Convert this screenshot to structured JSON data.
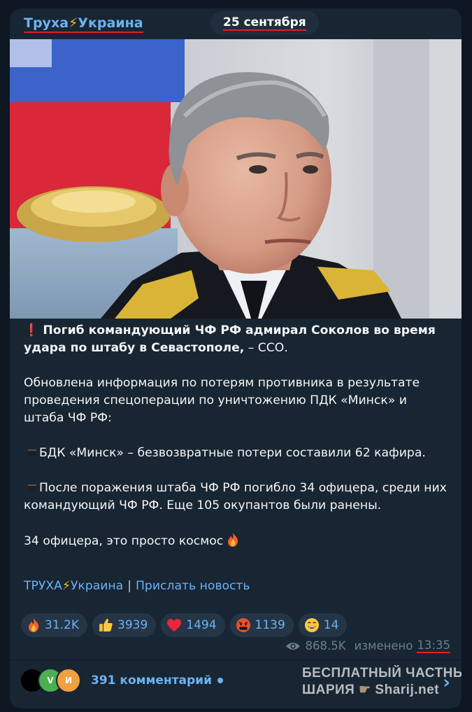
{
  "header": {
    "channel_prefix": "Труха",
    "channel_bolt": "⚡",
    "channel_suffix": "Украина",
    "date": "25 сентября"
  },
  "post": {
    "headline_mark": "❗",
    "headline": "Погиб командующий ЧФ РФ адмирал Соколов во время удара по штабу в Севастополе,",
    "headline_tail": " – ССО.",
    "paragraph1": "Обновлена   информация по потерям противника в результате проведения спецоперации по уничтожению ПДК «Минск» и штаба ЧФ РФ:",
    "item1": "БДК «Минск» – безвозвратные потери составили 62 кафира.",
    "item2": "После поражения штаба ЧФ РФ погибло 34 офицера, среди них командующий ЧФ РФ. Еще 105 окупантов были ранены.",
    "closing": "34 офицера, это просто космос"
  },
  "links": {
    "channel_link_prefix": "ТРУХА",
    "channel_link_bolt": "⚡",
    "channel_link_suffix": "Украина",
    "separator": "|",
    "submit_link": "Прислать новость"
  },
  "reactions": [
    {
      "icon": "fire-icon",
      "count": "31.2K"
    },
    {
      "icon": "thumbs-up-icon",
      "count": "3939"
    },
    {
      "icon": "heart-icon",
      "count": "1494"
    },
    {
      "icon": "angry-face-icon",
      "count": "1139"
    },
    {
      "icon": "grinning-face-icon",
      "count": "14"
    }
  ],
  "meta": {
    "views": "868.5K",
    "edited_label": "изменено",
    "time": "13:35"
  },
  "comments": {
    "avatars": [
      "",
      "V",
      "И"
    ],
    "label": "391 комментарий"
  },
  "watermark": {
    "line1": "БЕСПЛАТНЫЙ ЧАСТНЫЙ",
    "line2_left": "ШАРИЯ",
    "line2_right": "Sharij.net"
  },
  "colors": {
    "background": "#0e1621",
    "bubble": "#182533",
    "accent": "#6ab3f3",
    "underline": "#e0202a"
  }
}
